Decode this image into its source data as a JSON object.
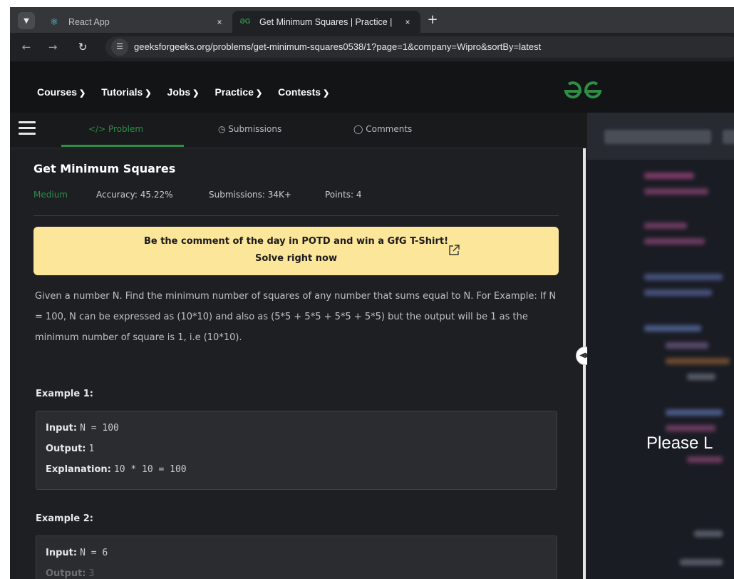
{
  "browser": {
    "tabs": [
      {
        "title": "React App",
        "icon": "react-icon",
        "close": "×"
      },
      {
        "title": "Get Minimum Squares | Practice |",
        "icon": "gfg-favicon",
        "close": "×"
      }
    ],
    "new_tab": "+",
    "url": "geeksforgeeks.org/problems/get-minimum-squares0538/1?page=1&company=Wipro&sortBy=latest"
  },
  "nav": {
    "menu": [
      "Courses",
      "Tutorials",
      "Jobs",
      "Practice",
      "Contests"
    ]
  },
  "subnav": {
    "tabs": [
      "</> Problem",
      "Submissions",
      "Comments"
    ]
  },
  "problem": {
    "title": "Get Minimum Squares",
    "difficulty": "Medium",
    "accuracy": "Accuracy: 45.22%",
    "submissions": "Submissions: 34K+",
    "points": "Points: 4"
  },
  "banner": {
    "line1": "Be the comment of the day in POTD and win a GfG T-Shirt!",
    "line2": "Solve right now"
  },
  "description": "Given a number N. Find the minimum number of squares of any number that sums equal to N. For Example: If N = 100, N can be expressed as (10*10) and also as (5*5 + 5*5 + 5*5 + 5*5) but the output will be 1 as the minimum number of square is 1, i.e (10*10).",
  "examples": [
    {
      "label": "Example 1:",
      "input_label": "Input:",
      "input": "N = 100",
      "output_label": "Output:",
      "output": "1",
      "explanation_label": "Explanation:",
      "explanation": "10 * 10 = 100"
    },
    {
      "label": "Example 2:",
      "input_label": "Input:",
      "input": "N = 6",
      "output_label": "Output:",
      "output": "3"
    }
  ],
  "editor": {
    "overlay_text": "Please L"
  },
  "colors": {
    "gfg_green": "#2f8d46",
    "banner_yellow": "#fbe69a",
    "dark_bg": "#1d1f23"
  }
}
